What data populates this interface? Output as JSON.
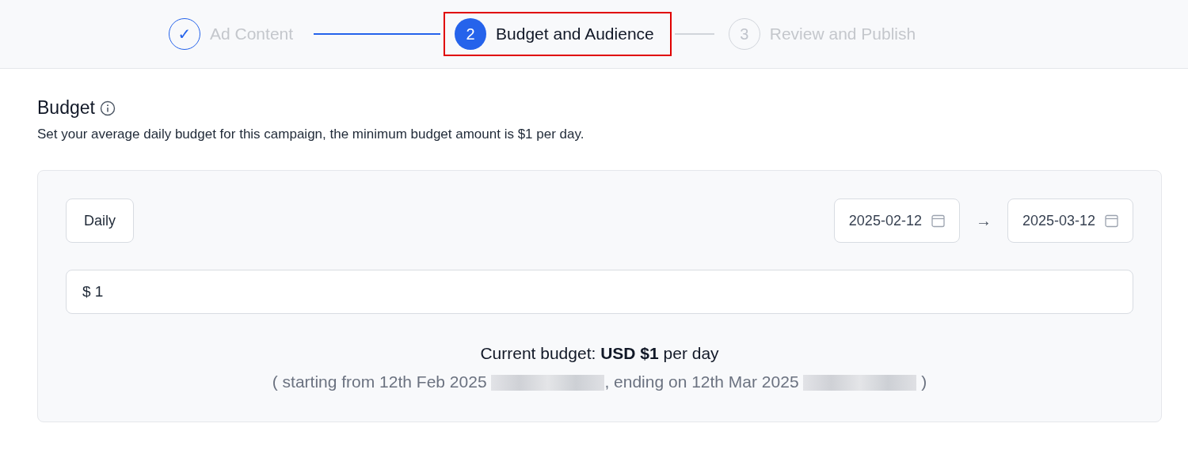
{
  "steps": [
    {
      "number": "✓",
      "label": "Ad Content",
      "kind": "done",
      "highlighted": false
    },
    {
      "number": "2",
      "label": "Budget and Audience",
      "kind": "current",
      "highlighted": true
    },
    {
      "number": "3",
      "label": "Review and Publish",
      "kind": "upcoming",
      "highlighted": false
    }
  ],
  "budget": {
    "title": "Budget",
    "description": "Set your average daily budget for this campaign, the minimum budget amount is $1 per day.",
    "mode_button": "Daily",
    "start_date": "2025-02-12",
    "arrow": "→",
    "end_date": "2025-03-12",
    "amount": "$ 1",
    "summary": "Current budget:  **USD $1** per day",
    "period": [
      {
        "kind": "text",
        "text": "( starting from 12th Feb 2025 "
      },
      {
        "kind": "redacted"
      },
      {
        "kind": "text",
        "text": ", ending on 12th Mar 2025 "
      },
      {
        "kind": "redacted"
      },
      {
        "kind": "text",
        "text": " )"
      }
    ]
  }
}
